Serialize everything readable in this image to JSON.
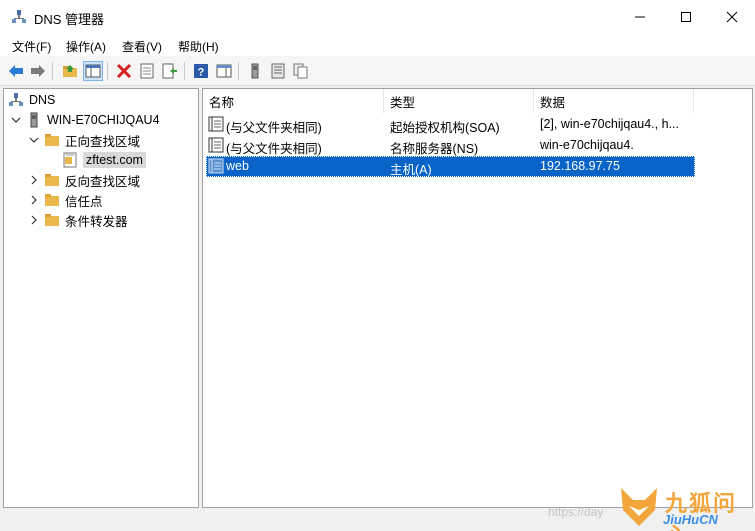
{
  "window": {
    "title": "DNS 管理器",
    "controls": {
      "minimize": "minimize-icon",
      "maximize": "maximize-icon",
      "close": "close-icon"
    }
  },
  "menu": [
    "文件(F)",
    "操作(A)",
    "查看(V)",
    "帮助(H)"
  ],
  "toolbar": [
    "back-arrow-icon",
    "forward-arrow-icon",
    "up-folder-icon",
    "show-tree-icon",
    "delete-icon",
    "properties-icon",
    "export-icon",
    "help-icon",
    "action-pane-icon",
    "server-icon",
    "list-view-icon",
    "copy-icon"
  ],
  "tree": {
    "root": "DNS",
    "server": "WIN-E70CHIJQAU4",
    "forward_zones": "正向查找区域",
    "zone": "zftest.com",
    "reverse_zones": "反向查找区域",
    "trust_points": "信任点",
    "conditional_forwarders": "条件转发器"
  },
  "list": {
    "columns": [
      "名称",
      "类型",
      "数据"
    ],
    "rows": [
      {
        "name": "(与父文件夹相同)",
        "type": "起始授权机构(SOA)",
        "data": "[2], win-e70chijqau4., h..."
      },
      {
        "name": "(与父文件夹相同)",
        "type": "名称服务器(NS)",
        "data": "win-e70chijqau4."
      },
      {
        "name": "web",
        "type": "主机(A)",
        "data": "192.168.97.75"
      }
    ],
    "selected_row": 2
  },
  "watermark": {
    "url": "https://day",
    "brand_cn": "九狐问心",
    "brand_en": "JiuHuCN"
  },
  "colors": {
    "selection": "#0a64c8",
    "folder": "#e8b84a",
    "logo_orange": "#f3a63b",
    "logo_blue": "#3a8ee6"
  }
}
